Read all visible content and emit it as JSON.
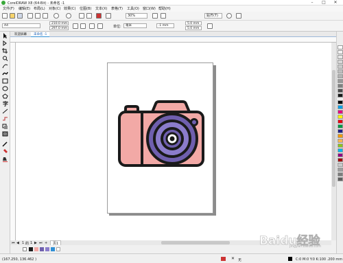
{
  "window": {
    "title": "CorelDRAW X8 (64-Bit) - 未命名 -1",
    "minimize": "–",
    "maximize": "□",
    "close": "✕"
  },
  "menu": [
    {
      "label": "文件(F)"
    },
    {
      "label": "编辑(E)"
    },
    {
      "label": "布局(L)"
    },
    {
      "label": "对象(C)"
    },
    {
      "label": "效果(C)"
    },
    {
      "label": "位图(B)"
    },
    {
      "label": "文本(X)"
    },
    {
      "label": "表格(T)"
    },
    {
      "label": "工具(O)"
    },
    {
      "label": "窗口(W)"
    },
    {
      "label": "帮助(H)"
    }
  ],
  "toolbar": {
    "zoom_value": "30%",
    "snap_label": "贴齐(T)"
  },
  "property_bar": {
    "page_size": "A4",
    "width": "210.0 mm",
    "height": "297.0 mm",
    "units_label": "单位:",
    "units_value": "毫米",
    "nudge": ".1 mm",
    "dup_x": "5.0 mm",
    "dup_y": "5.0 mm"
  },
  "tabs": [
    {
      "label": "欢迎屏幕"
    },
    {
      "label": "未命名 -1"
    }
  ],
  "page_nav": {
    "current": "1",
    "of_label": "的",
    "total": "1",
    "page_tab": "页1"
  },
  "status": {
    "coords": "(167.250, 136.462 )",
    "fill_label": "无",
    "color_info": "C:0 M:0 Y:0 K:100  .200 mm"
  },
  "watermark_text": "Baidu经验",
  "watermark_url": "jingyan.baidu.com",
  "colors": {
    "camera_body": "#f2a9a6",
    "camera_outline": "#1a1a1a",
    "lens_outer": "#6f5fae",
    "lens_inner": "#8b7ccb",
    "accent_blue": "#2f8fd6"
  }
}
